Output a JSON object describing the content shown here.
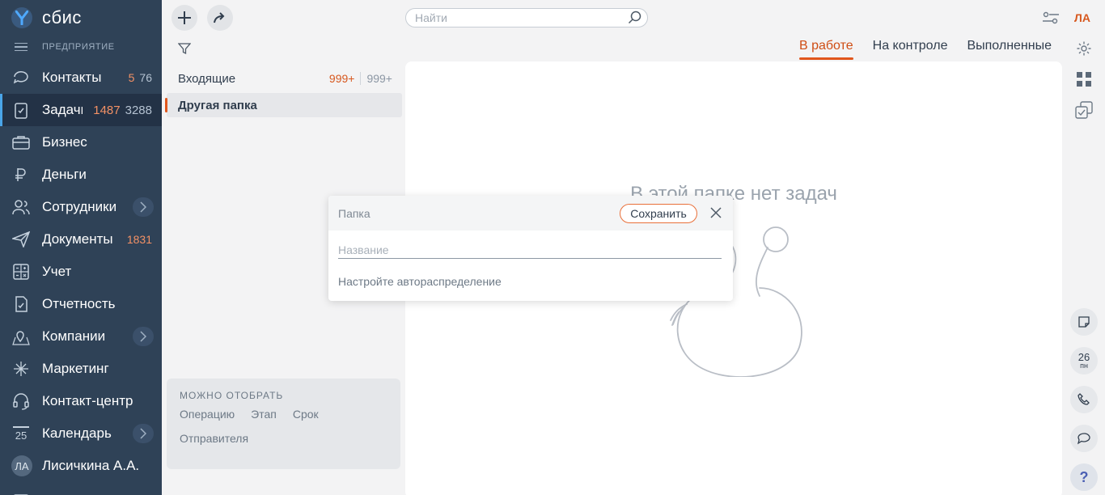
{
  "app": {
    "logo_text": "сбис",
    "section": "ПРЕДПРИЯТИЕ"
  },
  "sidebar": {
    "items": [
      {
        "label": "Контакты",
        "icon": "chat-bubble-icon",
        "count_new": "5",
        "count_total": "76"
      },
      {
        "label": "Задачи",
        "icon": "clipboard-check-icon",
        "count_new": "1487",
        "count_total": "3288",
        "active": true
      },
      {
        "label": "Бизнес",
        "icon": "briefcase-icon"
      },
      {
        "label": "Деньги",
        "icon": "ruble-icon"
      },
      {
        "label": "Сотрудники",
        "icon": "people-icon",
        "has_submenu": true
      },
      {
        "label": "Документы",
        "icon": "send-icon",
        "count_new": "1831"
      },
      {
        "label": "Учет",
        "icon": "calculator-icon"
      },
      {
        "label": "Отчетность",
        "icon": "report-icon"
      },
      {
        "label": "Компании",
        "icon": "map-pin-icon",
        "has_submenu": true
      },
      {
        "label": "Маркетинг",
        "icon": "sparkle-icon"
      },
      {
        "label": "Контакт-центр",
        "icon": "headset-icon"
      },
      {
        "label": "Календарь",
        "icon": "calendar-icon",
        "date": "25",
        "has_submenu": true
      }
    ],
    "user": {
      "initials": "ЛА",
      "name": "Лисичкина А.А."
    }
  },
  "search": {
    "placeholder": "Найти"
  },
  "folders": [
    {
      "label": "Входящие",
      "count_new": "999+",
      "count_total": "999+"
    },
    {
      "label": "Другая папка",
      "selected": true
    }
  ],
  "filter_box": {
    "title": "МОЖНО ОТОБРАТЬ",
    "options": [
      "Операцию",
      "Этап",
      "Срок",
      "Отправителя"
    ]
  },
  "tabs": [
    {
      "label": "В работе",
      "active": true
    },
    {
      "label": "На контроле"
    },
    {
      "label": "Выполненные"
    }
  ],
  "empty_state": {
    "text": "В этой папке нет задач"
  },
  "dialog": {
    "title": "Папка",
    "save_label": "Сохранить",
    "name_placeholder": "Название",
    "auto_link": "Настройте автораспределение"
  },
  "right_rail": {
    "user_initials": "ЛА",
    "calendar_day": "26",
    "calendar_weekday": "пн",
    "help": "?"
  },
  "colors": {
    "sidebar_bg": "#2f4257",
    "accent": "#e0561c",
    "counter_orange": "#f39165"
  }
}
